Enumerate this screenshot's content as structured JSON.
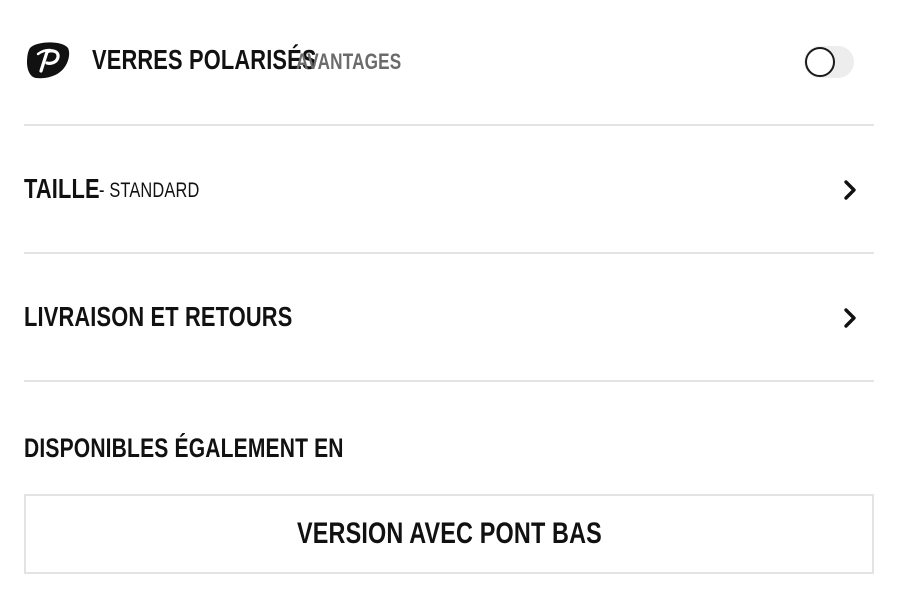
{
  "polarized": {
    "title": "VERRES POLARISÉS",
    "link_label": "AVANTAGES",
    "logo_icon": "polarized-p-logo-icon",
    "toggle_on": false
  },
  "size": {
    "label": "TAILLE",
    "value": "- STANDARD",
    "icon": "chevron-right-icon"
  },
  "shipping": {
    "label": "LIVRAISON ET RETOURS",
    "icon": "chevron-right-icon"
  },
  "also_available": {
    "title": "DISPONIBLES ÉGALEMENT EN",
    "variant_label": "VERSION AVEC PONT BAS"
  },
  "colors": {
    "text": "#111111",
    "muted": "#6b6b6b",
    "divider": "#e3e3e3",
    "toggle_track": "#ededed"
  }
}
